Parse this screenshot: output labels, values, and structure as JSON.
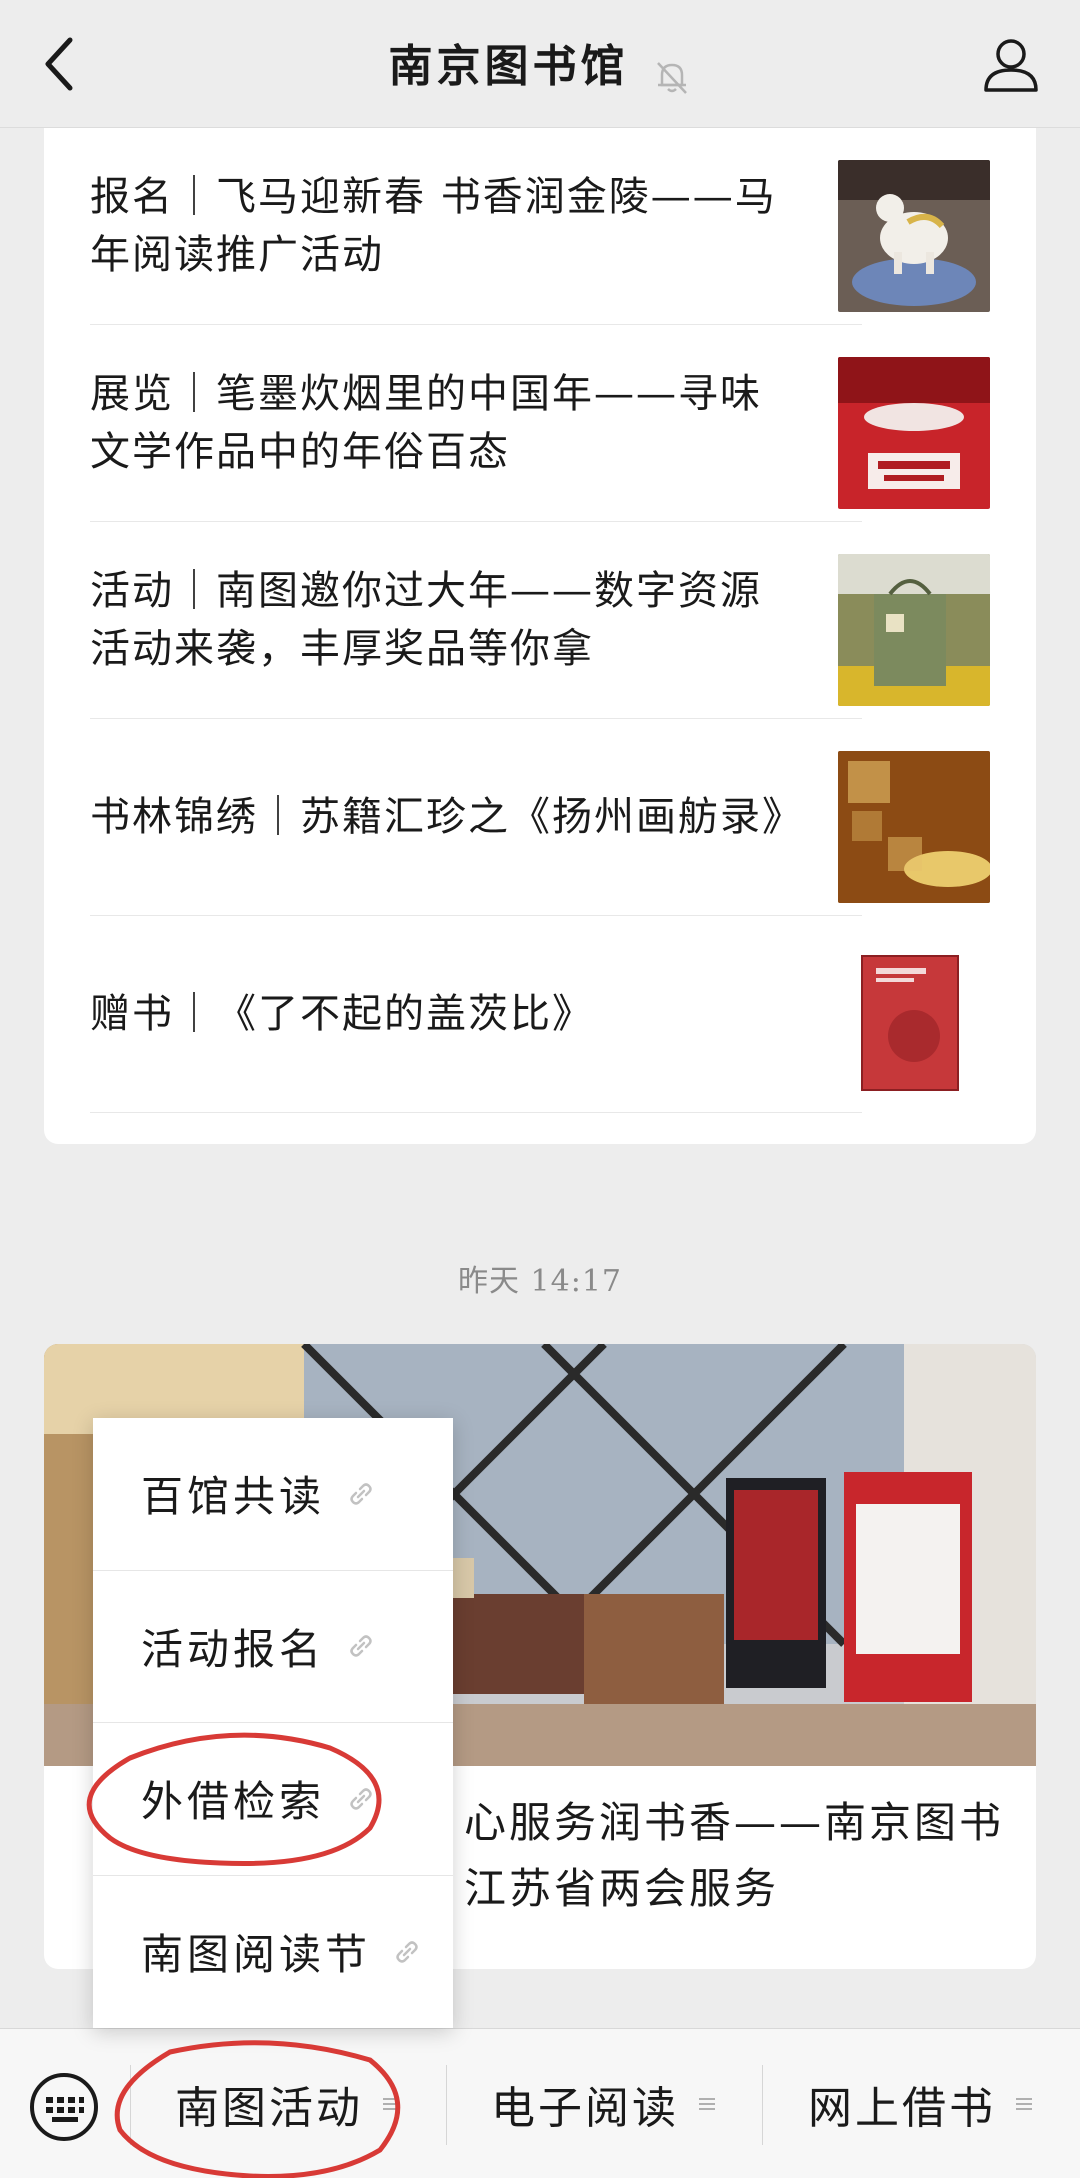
{
  "header": {
    "title": "南京图书馆"
  },
  "articles": [
    {
      "title": "报名｜飞马迎新春 书香润金陵——马年阅读推广活动",
      "thumb": "horse-figurine"
    },
    {
      "title": "展览｜笔墨炊烟里的中国年——寻味文学作品中的年俗百态",
      "thumb": "exhibition-poster"
    },
    {
      "title": "活动｜南图邀你过大年——数字资源活动来袭，丰厚奖品等你拿",
      "thumb": "gift-bag"
    },
    {
      "title": "书林锦绣｜苏籍汇珍之《扬州画舫录》",
      "thumb": "ancient-book"
    },
    {
      "title": "赠书｜《了不起的盖茨比》",
      "thumb": "book-cover"
    }
  ],
  "timestamp": "昨天 14:17",
  "feature_article": {
    "title": "用心服务润书香——南京图书馆江苏省两会服务",
    "visible_title_line1": "心服务润书香——南京图书",
    "visible_title_line2": "江苏省两会服务"
  },
  "popup_menu": {
    "items": [
      "百馆共读",
      "活动报名",
      "外借检索",
      "南图阅读节"
    ]
  },
  "bottom_menu": {
    "items": [
      "南图活动",
      "电子阅读",
      "网上借书"
    ]
  },
  "colors": {
    "annotation_red": "#d83a36",
    "background": "#ededed"
  }
}
